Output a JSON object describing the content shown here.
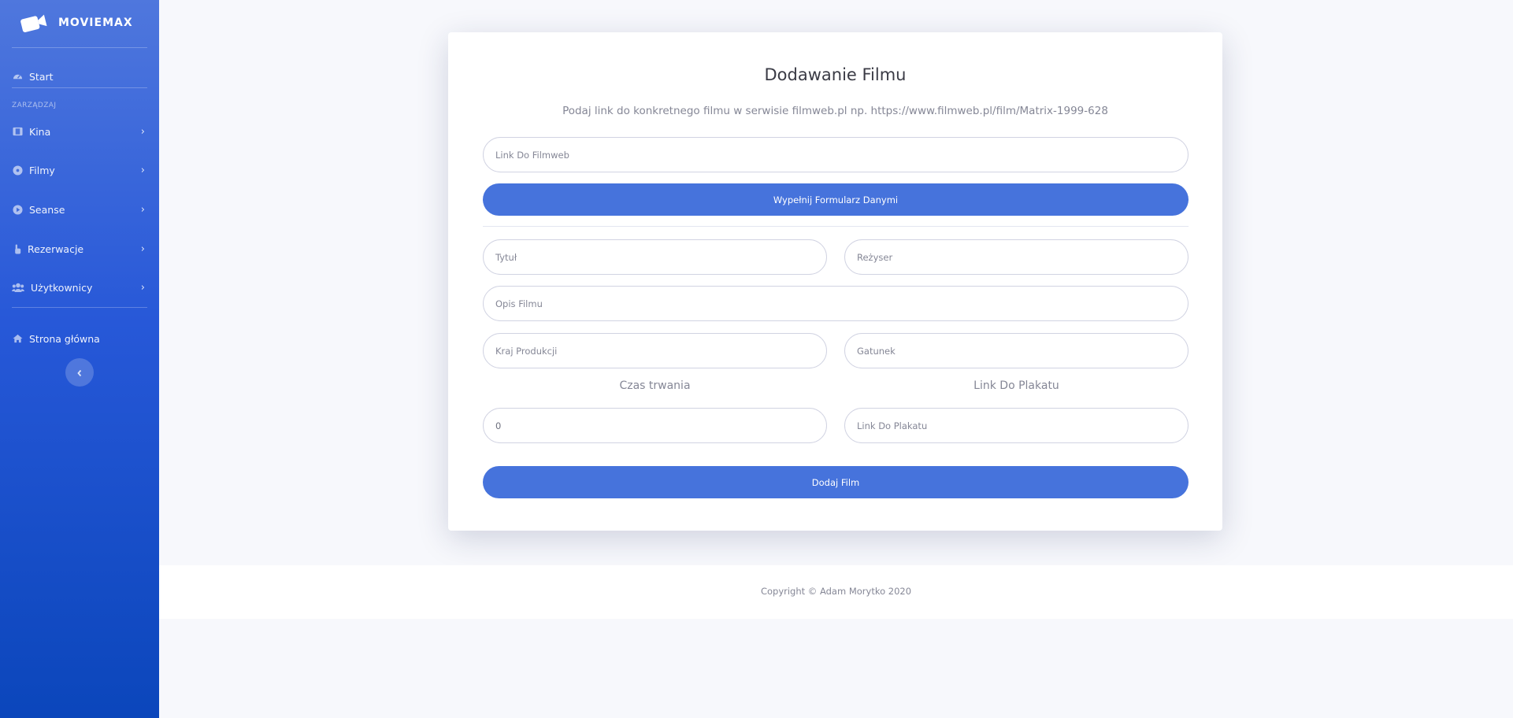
{
  "sidebar": {
    "brand": "MOVIEMAX",
    "start_label": "Start",
    "section_heading": "ZARZĄDZAJ",
    "items": [
      {
        "label": "Kina"
      },
      {
        "label": "Filmy"
      },
      {
        "label": "Seanse"
      },
      {
        "label": "Rezerwacje"
      },
      {
        "label": "Użytkownicy"
      }
    ],
    "home_label": "Strona główna"
  },
  "form": {
    "title": "Dodawanie Filmu",
    "subtitle": "Podaj link do konkretnego filmu w serwisie filmweb.pl np. https://www.filmweb.pl/film/Matrix-1999-628",
    "filmweb_placeholder": "Link Do Filmweb",
    "fill_button": "Wypełnij Formularz Danymi",
    "title_placeholder": "Tytuł",
    "director_placeholder": "Reżyser",
    "description_placeholder": "Opis Filmu",
    "country_placeholder": "Kraj Produkcji",
    "genre_placeholder": "Gatunek",
    "duration_label": "Czas trwania",
    "duration_value": "0",
    "poster_label": "Link Do Plakatu",
    "poster_placeholder": "Link Do Plakatu",
    "submit_button": "Dodaj Film"
  },
  "footer": {
    "copyright": "Copyright © Adam Morytko 2020"
  }
}
